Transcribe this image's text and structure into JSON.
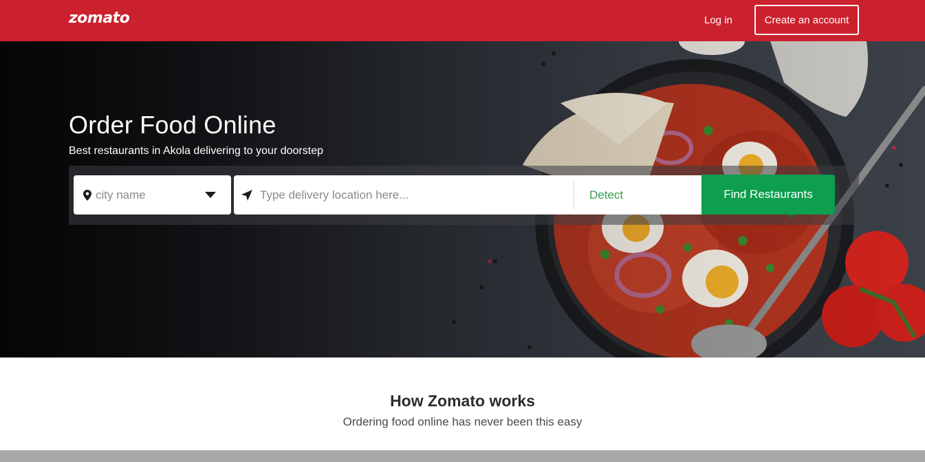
{
  "header": {
    "logo": "zomato",
    "login_label": "Log in",
    "signup_label": "Create an account"
  },
  "hero": {
    "title": "Order Food Online",
    "subtitle": "Best restaurants in Akola delivering to your doorstep"
  },
  "search": {
    "city_placeholder": "city name",
    "location_placeholder": "Type delivery location here...",
    "detect_label": "Detect",
    "find_label": "Find Restaurants"
  },
  "how": {
    "title": "How Zomato works",
    "subtitle": "Ordering food online has never been this easy"
  },
  "colors": {
    "brand_red": "#cb202d",
    "cta_green": "#0d9e4f",
    "detect_green": "#3a9a4e"
  },
  "icons": [
    "map-pin-icon",
    "chevron-down-icon",
    "location-arrow-icon"
  ]
}
